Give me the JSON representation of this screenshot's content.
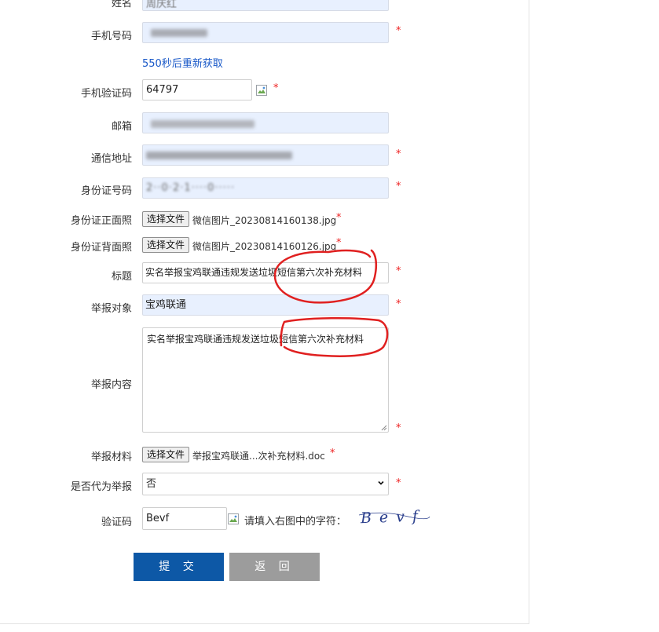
{
  "labels": {
    "name": "姓名",
    "phone": "手机号码",
    "sms_code": "手机验证码",
    "email": "邮箱",
    "address": "通信地址",
    "id_number": "身份证号码",
    "id_front": "身份证正面照",
    "id_back": "身份证背面照",
    "title": "标题",
    "target": "举报对象",
    "content": "举报内容",
    "materials": "举报材料",
    "proxy": "是否代为举报",
    "captcha": "验证码"
  },
  "values": {
    "name_partial": "周庆红",
    "sms_code": "64797",
    "id_partial": "2··0·2·1····0·····",
    "title": "实名举报宝鸡联通违规发送垃圾短信第六次补充材料",
    "target": "宝鸡联通",
    "content": "实名举报宝鸡联通违规发送垃圾短信第六次补充材料",
    "proxy_selected": "否",
    "captcha_input": "Bevf",
    "captcha_image_text": "Bevf"
  },
  "resend_link": "550秒后重新获取",
  "file_button": "选择文件",
  "files": {
    "id_front": "微信图片_20230814160138.jpg",
    "id_back": "微信图片_20230814160126.jpg",
    "materials": "举报宝鸡联通...次补充材料.doc"
  },
  "required_mark": "*",
  "captcha_hint": "请填入右图中的字符：",
  "buttons": {
    "submit": "提 交",
    "back": "返 回"
  },
  "icons": {
    "broken_image": "broken-image-icon",
    "select_chevron": "chevron-down-icon",
    "resize_grip": "resize-grip-icon"
  },
  "colors": {
    "input_autofill": "#e8f0fe",
    "link": "#1a59c8",
    "required": "#ee2222",
    "submit": "#0d58a6",
    "back": "#9c9c9c",
    "annotation": "#e02020",
    "captcha_ink": "#2a3e8c"
  }
}
